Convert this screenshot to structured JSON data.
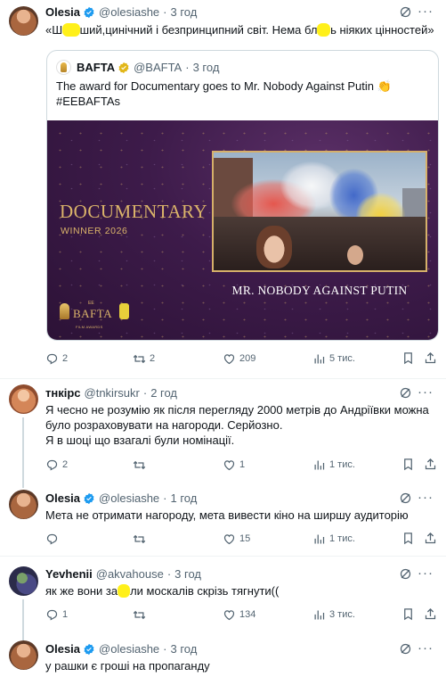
{
  "colors": {
    "text": "#0f1419",
    "secondary": "#536471",
    "verified": "#1d9bf0",
    "highlight": "#fff01a",
    "gold": "#dbb46a",
    "card_bg": "#3d1b4a"
  },
  "tweets": [
    {
      "name": "Olesia",
      "verified": true,
      "handle": "@olesiashe",
      "time": "3 год",
      "text_parts": [
        "«Ш",
        "ший,цинічний і безпринципний світ. Нема бл",
        "ь ніяких цінностей»"
      ],
      "quote": {
        "name": "BAFTA",
        "verified": true,
        "handle": "@BAFTA",
        "time": "3 год",
        "text": "The award for Documentary goes to Mr. Nobody Against Putin 👏",
        "hashtag": "#EEBAFTAs",
        "image": {
          "category": "DOCUMENTARY",
          "subtitle": "WINNER 2026",
          "film": "MR. NOBODY AGAINST PUTIN",
          "brand": "BAFTA",
          "brand_small": "EE",
          "brand_sub": "FILM AWARDS"
        }
      },
      "stats": {
        "replies": "2",
        "retweets": "2",
        "likes": "209",
        "views": "5 тис."
      }
    },
    {
      "name": "тнкірс",
      "verified": false,
      "handle": "@tnkirsukr",
      "time": "2 год",
      "text": "Я чесно не розумію як після перегляду 2000 метрів до Андріївки можна було розраховувати на нагороди. Серйозно.\nЯ в шоці що взагалі були номінації.",
      "stats": {
        "replies": "2",
        "retweets": "",
        "likes": "1",
        "views": "1 тис."
      }
    },
    {
      "name": "Olesia",
      "verified": true,
      "handle": "@olesiashe",
      "time": "1 год",
      "text": "Мета не отримати нагороду, мета вивести кіно на ширшу аудиторію",
      "stats": {
        "replies": "",
        "retweets": "",
        "likes": "15",
        "views": "1 тис."
      }
    },
    {
      "name": "Yevhenii",
      "verified": false,
      "handle": "@akvahouse",
      "time": "3 год",
      "text_parts": [
        "як же вони за",
        "ли москалів скрізь тягнути(("
      ],
      "stats": {
        "replies": "1",
        "retweets": "",
        "likes": "134",
        "views": "3 тис."
      }
    },
    {
      "name": "Olesia",
      "verified": true,
      "handle": "@olesiashe",
      "time": "3 год",
      "text": "у рашки є гроші на пропаганду",
      "stats": {}
    }
  ],
  "icons": {
    "reply": "reply-icon",
    "retweet": "retweet-icon",
    "like": "heart-icon",
    "views": "views-icon",
    "bookmark": "bookmark-icon",
    "share": "share-icon",
    "grok": "grok-icon",
    "more": "more-icon",
    "verified": "verified-badge-icon"
  }
}
